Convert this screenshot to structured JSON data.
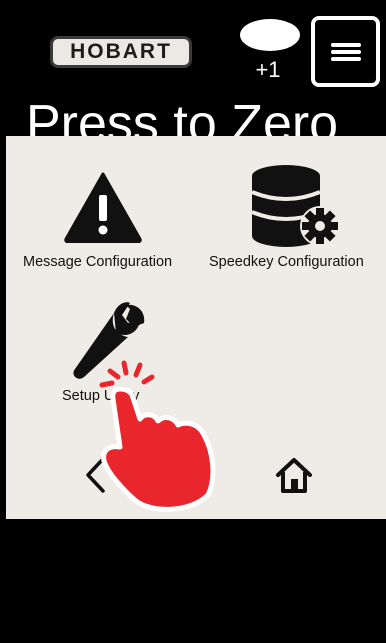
{
  "header": {
    "brand": "HOBART",
    "counter": "+1",
    "headline": "Press to Zero",
    "menu_icon": "hamburger-menu-icon"
  },
  "menu": {
    "items": [
      {
        "label": "Message Configuration",
        "icon": "warning-triangle-icon"
      },
      {
        "label": "Speedkey Configuration",
        "icon": "database-gear-icon"
      },
      {
        "label": "Setup Utility",
        "icon": "wrench-icon"
      }
    ],
    "back_icon": "chevron-left-icon",
    "home_icon": "home-icon"
  },
  "overlay": {
    "icon": "tap-hand-icon"
  },
  "colors": {
    "panel": "#efece8",
    "screen": "#000000",
    "hand": "#e8262b"
  }
}
